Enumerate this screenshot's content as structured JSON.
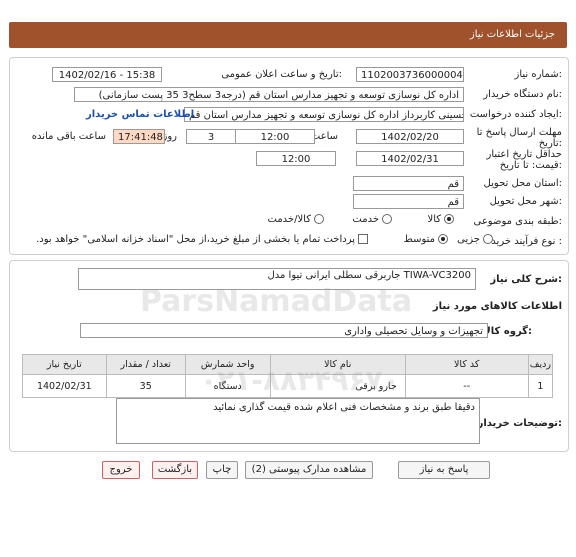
{
  "header": {
    "title": "جزئیات اطلاعات نیاز"
  },
  "info": {
    "need_number_label": "شماره نیاز:",
    "need_number": "1102003736000004",
    "announce_label": "تاریخ و ساعت اعلان عمومی:",
    "announce_value": "1402/02/16 - 15:38",
    "buyer_label": "نام دستگاه خریدار:",
    "buyer_value": "اداره کل نوسازی   توسعه و تجهیز مدارس استان قم (درجه3 سطح3  35 پست سازمانی)",
    "creator_label": "ایجاد کننده درخواست:",
    "creator_value": "سیدجلال حسینی کاربرداز اداره کل نوسازی   توسعه و تجهیز مدارس استان قم",
    "contact_link": "اطلاعات تماس خریدار",
    "deadline_label": "مهلت ارسال پاسخ تا تاریخ:",
    "deadline_date": "1402/02/20",
    "time_label": "ساعت",
    "deadline_time": "12:00",
    "days_value": "3",
    "days_label": "روز و",
    "remaining_time": "17:41:48",
    "remaining_label": "ساعت باقی مانده",
    "validity_label": "حداقل تاریخ اعتبار قیمت: تا تاریخ:",
    "validity_date": "1402/02/31",
    "validity_time": "12:00",
    "province_label": "استان محل تحویل:",
    "province_value": "قم",
    "city_label": "شهر محل تحویل:",
    "city_value": "قم",
    "category_label": "طبقه بندی موضوعی:",
    "cat_options": [
      "کالا",
      "خدمت",
      "کالا/خدمت"
    ],
    "process_label": "نوع فرآیند خرید :",
    "proc_options": [
      "جزیی",
      "متوسط"
    ],
    "payment_note": "پرداخت تمام یا بخشی از مبلغ خرید،از محل \"اسناد خزانه اسلامی\" خواهد بود."
  },
  "description": {
    "label": "شرح کلی نیاز:",
    "value": "جاربرقی سطلی ایرانی تیوا مدل TIWA-VC3200"
  },
  "goods": {
    "section_title": "اطلاعات کالاهای مورد نیاز",
    "group_label": "گروه کالا:",
    "group_value": "تجهیزات و وسایل تحصیلی واداری",
    "columns": [
      "ردیف",
      "کد کالا",
      "نام کالا",
      "واحد شمارش",
      "تعداد / مقدار",
      "تاریخ نیاز"
    ],
    "rows": [
      {
        "row": "1",
        "code": "--",
        "name": "جارو برقی",
        "unit": "دستگاه",
        "qty": "35",
        "date": "1402/02/31"
      }
    ]
  },
  "buyer_notes": {
    "label": "توضیحات خریدار:",
    "value": "دقیقا طبق برند و مشخصات فنی اعلام شده قیمت گذاری نمائید"
  },
  "buttons": {
    "reply": "پاسخ به نیاز",
    "attachments": "مشاهده مدارک پیوستی (2)",
    "print": "چاپ",
    "back": "بازگشت",
    "exit": "خروج"
  },
  "watermark": {
    "brand": "ParsNamadData",
    "phone": "۰۲۱-۸۸۳۴۹۶۷۰"
  }
}
